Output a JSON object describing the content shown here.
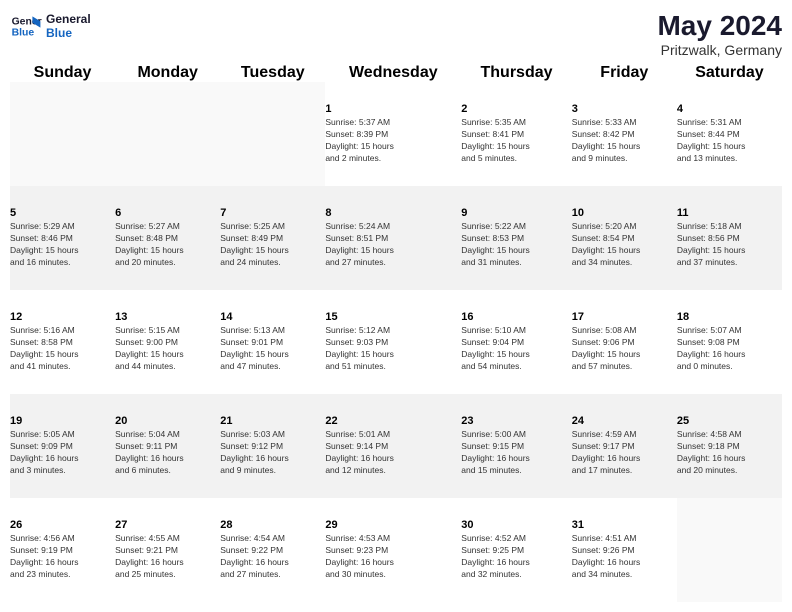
{
  "header": {
    "logo_line1": "General",
    "logo_line2": "Blue",
    "title": "May 2024",
    "subtitle": "Pritzwalk, Germany"
  },
  "weekdays": [
    "Sunday",
    "Monday",
    "Tuesday",
    "Wednesday",
    "Thursday",
    "Friday",
    "Saturday"
  ],
  "weeks": [
    [
      {
        "day": "",
        "info": ""
      },
      {
        "day": "",
        "info": ""
      },
      {
        "day": "",
        "info": ""
      },
      {
        "day": "1",
        "info": "Sunrise: 5:37 AM\nSunset: 8:39 PM\nDaylight: 15 hours\nand 2 minutes."
      },
      {
        "day": "2",
        "info": "Sunrise: 5:35 AM\nSunset: 8:41 PM\nDaylight: 15 hours\nand 5 minutes."
      },
      {
        "day": "3",
        "info": "Sunrise: 5:33 AM\nSunset: 8:42 PM\nDaylight: 15 hours\nand 9 minutes."
      },
      {
        "day": "4",
        "info": "Sunrise: 5:31 AM\nSunset: 8:44 PM\nDaylight: 15 hours\nand 13 minutes."
      }
    ],
    [
      {
        "day": "5",
        "info": "Sunrise: 5:29 AM\nSunset: 8:46 PM\nDaylight: 15 hours\nand 16 minutes."
      },
      {
        "day": "6",
        "info": "Sunrise: 5:27 AM\nSunset: 8:48 PM\nDaylight: 15 hours\nand 20 minutes."
      },
      {
        "day": "7",
        "info": "Sunrise: 5:25 AM\nSunset: 8:49 PM\nDaylight: 15 hours\nand 24 minutes."
      },
      {
        "day": "8",
        "info": "Sunrise: 5:24 AM\nSunset: 8:51 PM\nDaylight: 15 hours\nand 27 minutes."
      },
      {
        "day": "9",
        "info": "Sunrise: 5:22 AM\nSunset: 8:53 PM\nDaylight: 15 hours\nand 31 minutes."
      },
      {
        "day": "10",
        "info": "Sunrise: 5:20 AM\nSunset: 8:54 PM\nDaylight: 15 hours\nand 34 minutes."
      },
      {
        "day": "11",
        "info": "Sunrise: 5:18 AM\nSunset: 8:56 PM\nDaylight: 15 hours\nand 37 minutes."
      }
    ],
    [
      {
        "day": "12",
        "info": "Sunrise: 5:16 AM\nSunset: 8:58 PM\nDaylight: 15 hours\nand 41 minutes."
      },
      {
        "day": "13",
        "info": "Sunrise: 5:15 AM\nSunset: 9:00 PM\nDaylight: 15 hours\nand 44 minutes."
      },
      {
        "day": "14",
        "info": "Sunrise: 5:13 AM\nSunset: 9:01 PM\nDaylight: 15 hours\nand 47 minutes."
      },
      {
        "day": "15",
        "info": "Sunrise: 5:12 AM\nSunset: 9:03 PM\nDaylight: 15 hours\nand 51 minutes."
      },
      {
        "day": "16",
        "info": "Sunrise: 5:10 AM\nSunset: 9:04 PM\nDaylight: 15 hours\nand 54 minutes."
      },
      {
        "day": "17",
        "info": "Sunrise: 5:08 AM\nSunset: 9:06 PM\nDaylight: 15 hours\nand 57 minutes."
      },
      {
        "day": "18",
        "info": "Sunrise: 5:07 AM\nSunset: 9:08 PM\nDaylight: 16 hours\nand 0 minutes."
      }
    ],
    [
      {
        "day": "19",
        "info": "Sunrise: 5:05 AM\nSunset: 9:09 PM\nDaylight: 16 hours\nand 3 minutes."
      },
      {
        "day": "20",
        "info": "Sunrise: 5:04 AM\nSunset: 9:11 PM\nDaylight: 16 hours\nand 6 minutes."
      },
      {
        "day": "21",
        "info": "Sunrise: 5:03 AM\nSunset: 9:12 PM\nDaylight: 16 hours\nand 9 minutes."
      },
      {
        "day": "22",
        "info": "Sunrise: 5:01 AM\nSunset: 9:14 PM\nDaylight: 16 hours\nand 12 minutes."
      },
      {
        "day": "23",
        "info": "Sunrise: 5:00 AM\nSunset: 9:15 PM\nDaylight: 16 hours\nand 15 minutes."
      },
      {
        "day": "24",
        "info": "Sunrise: 4:59 AM\nSunset: 9:17 PM\nDaylight: 16 hours\nand 17 minutes."
      },
      {
        "day": "25",
        "info": "Sunrise: 4:58 AM\nSunset: 9:18 PM\nDaylight: 16 hours\nand 20 minutes."
      }
    ],
    [
      {
        "day": "26",
        "info": "Sunrise: 4:56 AM\nSunset: 9:19 PM\nDaylight: 16 hours\nand 23 minutes."
      },
      {
        "day": "27",
        "info": "Sunrise: 4:55 AM\nSunset: 9:21 PM\nDaylight: 16 hours\nand 25 minutes."
      },
      {
        "day": "28",
        "info": "Sunrise: 4:54 AM\nSunset: 9:22 PM\nDaylight: 16 hours\nand 27 minutes."
      },
      {
        "day": "29",
        "info": "Sunrise: 4:53 AM\nSunset: 9:23 PM\nDaylight: 16 hours\nand 30 minutes."
      },
      {
        "day": "30",
        "info": "Sunrise: 4:52 AM\nSunset: 9:25 PM\nDaylight: 16 hours\nand 32 minutes."
      },
      {
        "day": "31",
        "info": "Sunrise: 4:51 AM\nSunset: 9:26 PM\nDaylight: 16 hours\nand 34 minutes."
      },
      {
        "day": "",
        "info": ""
      }
    ]
  ]
}
